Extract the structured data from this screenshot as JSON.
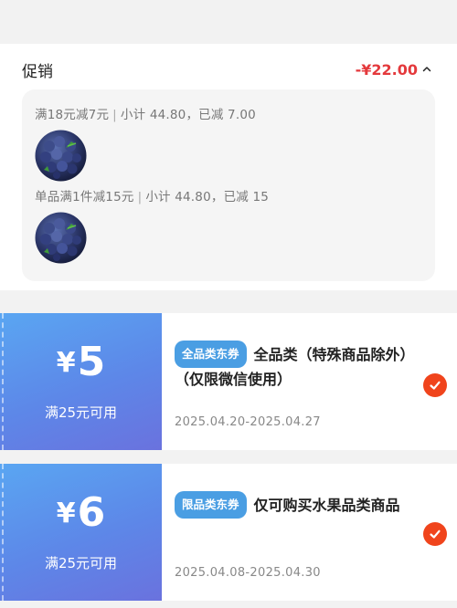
{
  "promotion": {
    "title": "促销",
    "total_discount": "-¥22.00",
    "rules": [
      {
        "label": "满18元减7元",
        "subtotal": "小计 44.80，已减 7.00",
        "item_image": "blueberry-photo"
      },
      {
        "label": "单品满1件减15元",
        "subtotal": "小计 44.80，已减 15",
        "item_image": "blueberry-photo"
      }
    ]
  },
  "coupons": [
    {
      "currency": "¥",
      "amount": "5",
      "condition": "满25元可用",
      "tag": "全品类东券",
      "title": "全品类（特殊商品除外）（仅限微信使用）",
      "validity": "2025.04.20-2025.04.27",
      "selected": true,
      "check_icon": "checkmark-circle-icon"
    },
    {
      "currency": "¥",
      "amount": "6",
      "condition": "满25元可用",
      "tag": "限品类东券",
      "title": "仅可购买水果品类商品",
      "validity": "2025.04.08-2025.04.30",
      "selected": true,
      "check_icon": "checkmark-circle-icon"
    }
  ],
  "colors": {
    "discount_red": "#e4393c",
    "coupon_gradient_start": "#5aa6f2",
    "coupon_gradient_end": "#6a72de",
    "tag_blue": "#4a9ee3",
    "check_orange": "#f0441c"
  }
}
